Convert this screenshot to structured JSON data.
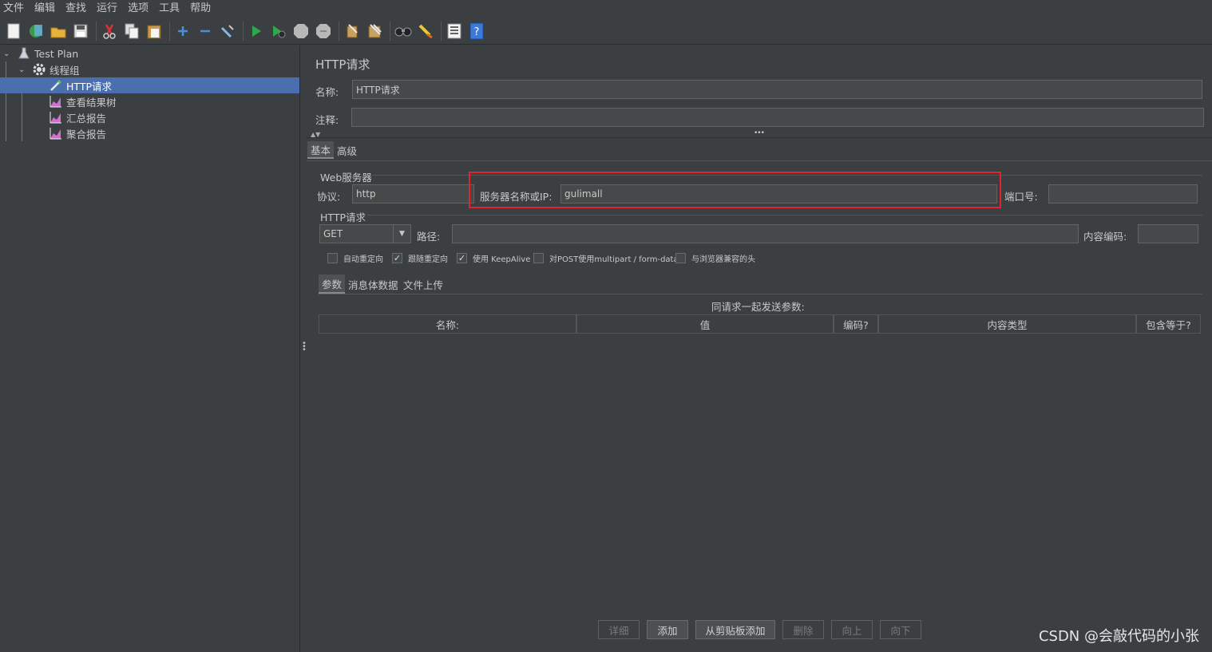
{
  "menu": [
    "文件",
    "编辑",
    "查找",
    "运行",
    "选项",
    "工具",
    "帮助"
  ],
  "toolbar_icons": [
    "new-icon",
    "templates-icon",
    "open-icon",
    "save-icon",
    "cut-icon",
    "copy-icon",
    "paste-icon",
    "expand-icon",
    "collapse-icon",
    "toggle-icon",
    "start-icon",
    "start-no-pause-icon",
    "stop-icon",
    "shutdown-icon",
    "clear-icon",
    "clear-all-icon",
    "search-icon",
    "reset-search-icon",
    "function-helper-icon",
    "help-icon"
  ],
  "tree": {
    "test_plan": "Test Plan",
    "thread_group": "线程组",
    "http_request": "HTTP请求",
    "view_results_tree": "查看结果树",
    "summary_report": "汇总报告",
    "aggregate_report": "聚合报告"
  },
  "panel": {
    "title": "HTTP请求",
    "name_label": "名称:",
    "name_value": "HTTP请求",
    "comment_label": "注释:",
    "comment_value": "",
    "tabs": [
      "基本",
      "高级"
    ],
    "web_server_group": "Web服务器",
    "protocol_label": "协议:",
    "protocol_value": "http",
    "server_label": "服务器名称或IP:",
    "server_value": "gulimall",
    "port_label": "端口号:",
    "port_value": "",
    "http_group": "HTTP请求",
    "method": "GET",
    "path_label": "路径:",
    "path_value": "",
    "encoding_label": "内容编码:",
    "encoding_value": "",
    "checkboxes": [
      {
        "label": "自动重定向",
        "checked": false
      },
      {
        "label": "跟随重定向",
        "checked": true
      },
      {
        "label": "使用 KeepAlive",
        "checked": true
      },
      {
        "label": "对POST使用multipart / form-data",
        "checked": false
      },
      {
        "label": "与浏览器兼容的头",
        "checked": false
      }
    ],
    "sub_tabs": [
      "参数",
      "消息体数据",
      "文件上传"
    ],
    "params_caption": "同请求一起发送参数:",
    "table_headers": [
      "名称:",
      "值",
      "编码?",
      "内容类型",
      "包含等于?"
    ],
    "buttons": [
      {
        "label": "详细",
        "enabled": false
      },
      {
        "label": "添加",
        "enabled": true
      },
      {
        "label": "从剪贴板添加",
        "enabled": true
      },
      {
        "label": "删除",
        "enabled": false
      },
      {
        "label": "向上",
        "enabled": false
      },
      {
        "label": "向下",
        "enabled": false
      }
    ]
  },
  "watermark": "CSDN @会敲代码的小张",
  "colors": {
    "selection": "#4b6eaf",
    "highlight_box": "#e0262b",
    "background": "#3c3f41"
  }
}
